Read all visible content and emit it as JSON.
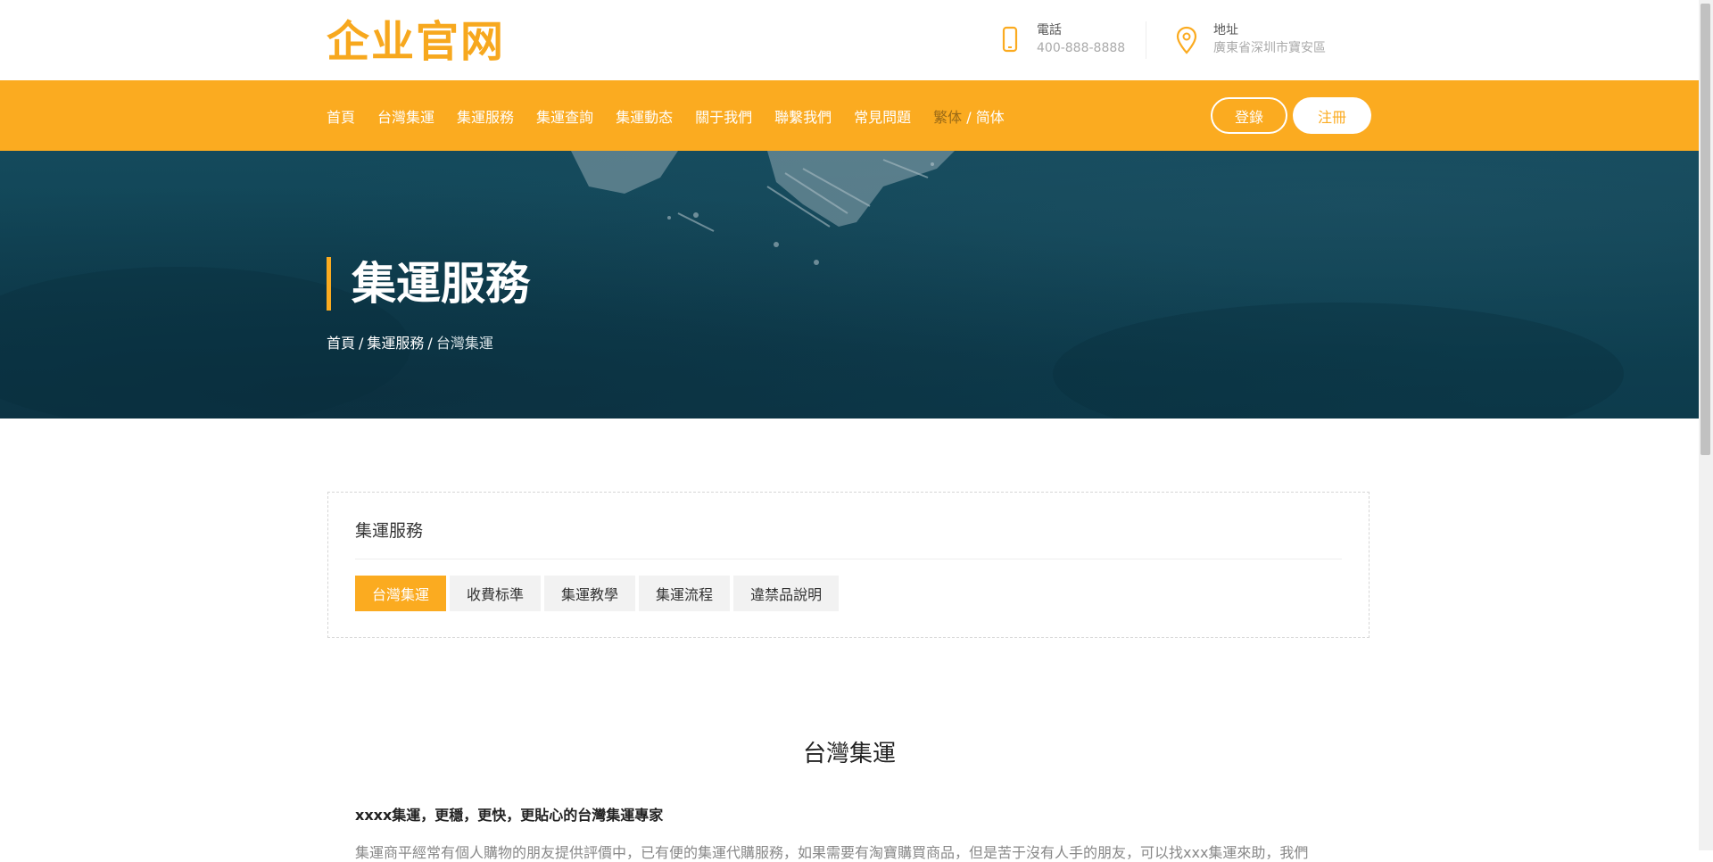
{
  "header": {
    "logo": "企业官网",
    "phone": {
      "label": "電話",
      "value": "400-888-8888",
      "icon": "phone-icon"
    },
    "address": {
      "label": "地址",
      "value": "廣東省深圳市寶安區",
      "icon": "map-pin-icon"
    }
  },
  "nav": {
    "items": [
      {
        "label": "首頁"
      },
      {
        "label": "台灣集運"
      },
      {
        "label": "集運服務"
      },
      {
        "label": "集運查詢"
      },
      {
        "label": "集運動态"
      },
      {
        "label": "關于我們"
      },
      {
        "label": "聯繫我們"
      },
      {
        "label": "常見問題"
      }
    ],
    "lang_traditional": "繁体",
    "lang_separator": "/",
    "lang_simplified": "简体",
    "login_label": "登錄",
    "register_label": "注冊"
  },
  "banner": {
    "title": "集運服務",
    "breadcrumb": {
      "home": "首頁",
      "sep": "/",
      "section": "集運服務",
      "current": "台灣集運"
    }
  },
  "category": {
    "title": "集運服務",
    "tabs": [
      {
        "label": "台灣集運",
        "active": true
      },
      {
        "label": "收費标準",
        "active": false
      },
      {
        "label": "集運教學",
        "active": false
      },
      {
        "label": "集運流程",
        "active": false
      },
      {
        "label": "違禁品說明",
        "active": false
      }
    ]
  },
  "article": {
    "title": "台灣集運",
    "subtitle": "xxxx集運，更穩，更快，更貼心的台灣集運專家",
    "body": "集運商平經常有個人購物的朋友提供評價中，已有便的集運代購服務，如果需要有淘寶購買商品，但是苦于沒有人手的朋友，可以找xxx集運來助，我們"
  },
  "colors": {
    "accent": "#fbab20",
    "banner": "#0f4152"
  }
}
